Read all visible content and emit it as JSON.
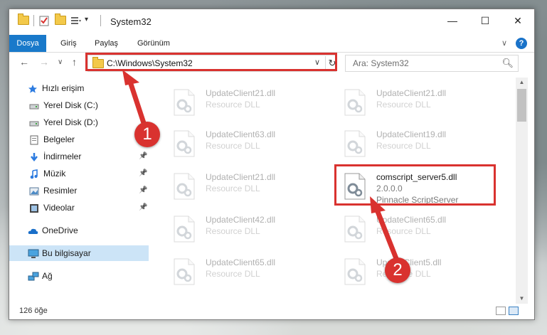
{
  "window": {
    "title": "System32",
    "minimize": "—",
    "maximize": "☐",
    "close": "✕"
  },
  "ribbon": {
    "tabs": [
      "Dosya",
      "Giriş",
      "Paylaş",
      "Görünüm"
    ],
    "expand": "∨",
    "help": "?"
  },
  "nav": {
    "back": "←",
    "forward": "→",
    "recent": "∨",
    "up": "↑",
    "address": "C:\\Windows\\System32",
    "refresh": "↻",
    "search_placeholder": "Ara: System32"
  },
  "sidebar": {
    "items": [
      {
        "label": "Hızlı erişim",
        "icon": "star-icon",
        "pinned": false
      },
      {
        "label": "Yerel Disk (C:)",
        "icon": "drive-icon",
        "pinned": false
      },
      {
        "label": "Yerel Disk (D:)",
        "icon": "drive-icon",
        "pinned": false
      },
      {
        "label": "Belgeler",
        "icon": "document-icon",
        "pinned": false
      },
      {
        "label": "İndirmeler",
        "icon": "download-icon",
        "pinned": true
      },
      {
        "label": "Müzik",
        "icon": "music-icon",
        "pinned": true
      },
      {
        "label": "Resimler",
        "icon": "pictures-icon",
        "pinned": true
      },
      {
        "label": "Videolar",
        "icon": "video-icon",
        "pinned": true
      },
      {
        "label": "OneDrive",
        "icon": "cloud-icon",
        "pinned": false
      },
      {
        "label": "Bu bilgisayar",
        "icon": "computer-icon",
        "pinned": false,
        "selected": true
      },
      {
        "label": "Ağ",
        "icon": "network-icon",
        "pinned": false
      }
    ]
  },
  "files": [
    {
      "name": "UpdateClient21.dll",
      "type": "Resource DLL",
      "faded": true
    },
    {
      "name": "UpdateClient21.dll",
      "type": "Resource DLL",
      "faded": true
    },
    {
      "name": "UpdateClient63.dll",
      "type": "Resource DLL",
      "faded": true
    },
    {
      "name": "UpdateClient19.dll",
      "type": "Resource DLL",
      "faded": true
    },
    {
      "name": "UpdateClient21.dll",
      "type": "Resource DLL",
      "faded": true
    },
    {
      "name": "comscript_server5.dll",
      "version": "2.0.0.0",
      "type": "Pinnacle ScriptServer",
      "faded": false
    },
    {
      "name": "UpdateClient42.dll",
      "type": "Resource DLL",
      "faded": true
    },
    {
      "name": "UpdateClient65.dll",
      "type": "Resource DLL",
      "faded": true
    },
    {
      "name": "UpdateClient65.dll",
      "type": "Resource DLL",
      "faded": true
    },
    {
      "name": "UpdateClient5.dll",
      "type": "Resource DLL",
      "faded": true
    }
  ],
  "status": {
    "count": "126 öğe"
  },
  "callouts": [
    "1",
    "2"
  ],
  "colors": {
    "accent": "#1979ca",
    "highlight": "#d9322f",
    "selected": "#cce4f7"
  }
}
